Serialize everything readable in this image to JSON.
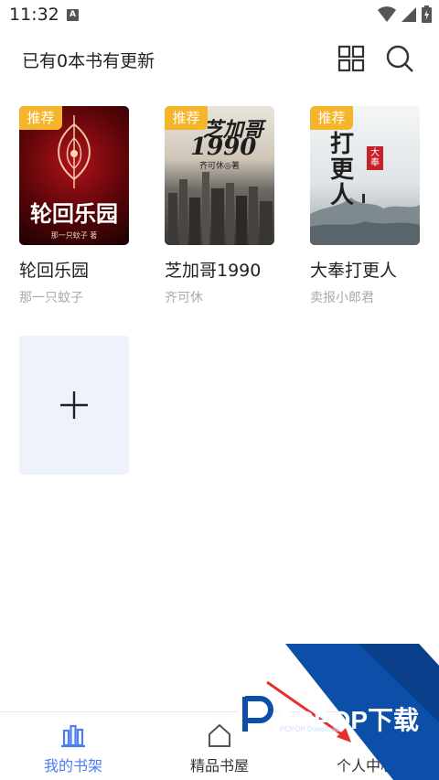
{
  "status_bar": {
    "time": "11:32",
    "notification_letter": "A"
  },
  "header": {
    "title": "已有0本书有更新"
  },
  "books": [
    {
      "badge": "推荐",
      "title": "轮回乐园",
      "author": "那一只蚊子",
      "cover_title": "轮回乐园",
      "cover_author": "那一只蚊子 著"
    },
    {
      "badge": "推荐",
      "title": "芝加哥1990",
      "author": "齐可休",
      "cover_title": "芝加哥",
      "cover_year": "1990",
      "cover_author": "齐可休◎著"
    },
    {
      "badge": "推荐",
      "title": "大奉打更人",
      "author": "卖报小郎君",
      "cover_title": "打更人",
      "cover_tag": "大奉"
    }
  ],
  "tabs": [
    {
      "label": "我的书架",
      "icon": "bookshelf-icon",
      "active": true
    },
    {
      "label": "精品书屋",
      "icon": "home-icon",
      "active": false
    },
    {
      "label": "个人中心",
      "icon": "person-icon",
      "active": false
    }
  ],
  "watermark": {
    "text": "PCPOP下载",
    "sub": "PCPOP Download"
  },
  "colors": {
    "accent": "#4a7ef0",
    "badge": "#f5b52a",
    "watermark_blue": "#0b4fa8"
  }
}
